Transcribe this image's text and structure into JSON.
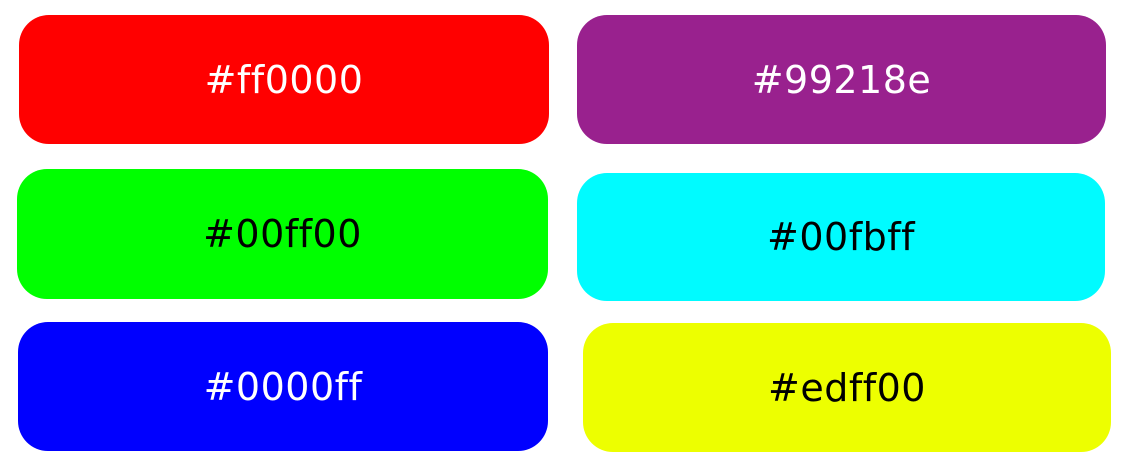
{
  "swatches": [
    {
      "label": "#ff0000",
      "color": "#ff0000",
      "text_color": "#ffffff"
    },
    {
      "label": "#99218e",
      "color": "#99218e",
      "text_color": "#ffffff"
    },
    {
      "label": "#00ff00",
      "color": "#00ff00",
      "text_color": "#000000"
    },
    {
      "label": "#00fbff",
      "color": "#00fbff",
      "text_color": "#000000"
    },
    {
      "label": "#0000ff",
      "color": "#0000ff",
      "text_color": "#ffffff"
    },
    {
      "label": "#edff00",
      "color": "#edff00",
      "text_color": "#000000"
    }
  ]
}
